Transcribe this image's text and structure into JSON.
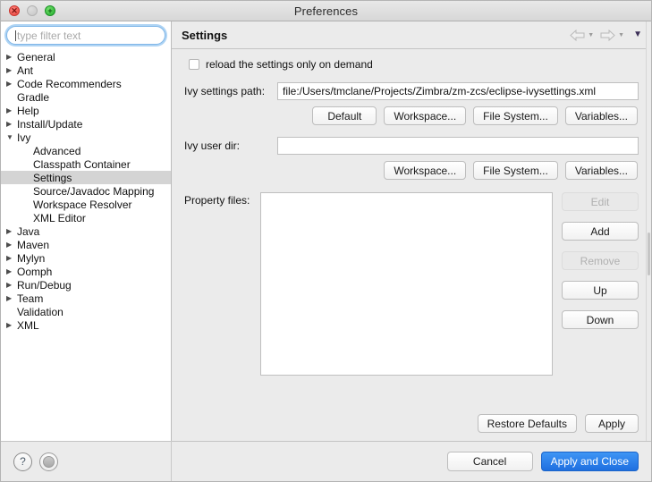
{
  "window": {
    "title": "Preferences",
    "traffic_lights": [
      {
        "name": "close",
        "glyph": "✕"
      },
      {
        "name": "minimize",
        "glyph": "–"
      },
      {
        "name": "zoom",
        "glyph": "+"
      }
    ]
  },
  "sidebar": {
    "filter": {
      "placeholder": "type filter text",
      "value": ""
    },
    "items": [
      {
        "label": "General",
        "twisty": "▶",
        "level": 0,
        "selected": false
      },
      {
        "label": "Ant",
        "twisty": "▶",
        "level": 0,
        "selected": false
      },
      {
        "label": "Code Recommenders",
        "twisty": "▶",
        "level": 0,
        "selected": false
      },
      {
        "label": "Gradle",
        "twisty": "",
        "level": 0,
        "selected": false
      },
      {
        "label": "Help",
        "twisty": "▶",
        "level": 0,
        "selected": false
      },
      {
        "label": "Install/Update",
        "twisty": "▶",
        "level": 0,
        "selected": false
      },
      {
        "label": "Ivy",
        "twisty": "▼",
        "level": 0,
        "selected": false
      },
      {
        "label": "Advanced",
        "twisty": "",
        "level": 1,
        "selected": false
      },
      {
        "label": "Classpath Container",
        "twisty": "",
        "level": 1,
        "selected": false
      },
      {
        "label": "Settings",
        "twisty": "",
        "level": 1,
        "selected": true
      },
      {
        "label": "Source/Javadoc Mapping",
        "twisty": "",
        "level": 1,
        "selected": false
      },
      {
        "label": "Workspace Resolver",
        "twisty": "",
        "level": 1,
        "selected": false
      },
      {
        "label": "XML Editor",
        "twisty": "",
        "level": 1,
        "selected": false
      },
      {
        "label": "Java",
        "twisty": "▶",
        "level": 0,
        "selected": false
      },
      {
        "label": "Maven",
        "twisty": "▶",
        "level": 0,
        "selected": false
      },
      {
        "label": "Mylyn",
        "twisty": "▶",
        "level": 0,
        "selected": false
      },
      {
        "label": "Oomph",
        "twisty": "▶",
        "level": 0,
        "selected": false
      },
      {
        "label": "Run/Debug",
        "twisty": "▶",
        "level": 0,
        "selected": false
      },
      {
        "label": "Team",
        "twisty": "▶",
        "level": 0,
        "selected": false
      },
      {
        "label": "Validation",
        "twisty": "",
        "level": 0,
        "selected": false
      },
      {
        "label": "XML",
        "twisty": "▶",
        "level": 0,
        "selected": false
      }
    ]
  },
  "content": {
    "title": "Settings",
    "nav": {
      "back_caret": "▼",
      "forward_caret": "▼",
      "menu_caret": "▼"
    },
    "reload_checkbox": {
      "label": "reload the settings only on demand",
      "checked": false
    },
    "settings_path": {
      "label": "Ivy settings path:",
      "value": "file:/Users/tmclane/Projects/Zimbra/zm-zcs/eclipse-ivysettings.xml",
      "buttons": [
        "Default",
        "Workspace...",
        "File System...",
        "Variables..."
      ]
    },
    "user_dir": {
      "label": "Ivy user dir:",
      "value": "",
      "buttons": [
        "Workspace...",
        "File System...",
        "Variables..."
      ]
    },
    "property_files": {
      "label": "Property files:",
      "items": [],
      "buttons": [
        {
          "label": "Edit",
          "enabled": false
        },
        {
          "label": "Add",
          "enabled": true
        },
        {
          "label": "Remove",
          "enabled": false
        },
        {
          "label": "Up",
          "enabled": true
        },
        {
          "label": "Down",
          "enabled": true
        }
      ]
    },
    "apply_row": {
      "restore_defaults": "Restore Defaults",
      "apply": "Apply"
    }
  },
  "footer": {
    "help_glyph": "?",
    "cancel": "Cancel",
    "apply_and_close": "Apply and Close"
  },
  "colors": {
    "accent": "#1f6fe0",
    "window_bg": "#ebebeb",
    "selection": "#d4d4d4",
    "focus_ring": "#7fb6e8"
  }
}
